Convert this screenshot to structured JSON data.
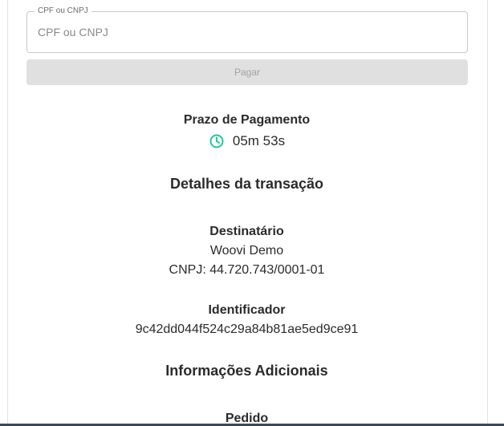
{
  "form": {
    "field_label": "CPF ou CNPJ",
    "field_placeholder": "CPF ou CNPJ",
    "field_value": "",
    "pay_button_label": "Pagar"
  },
  "payment_deadline": {
    "title": "Prazo de Pagamento",
    "time": "05m 53s",
    "icon": "clock-icon",
    "icon_color": "#1ec8a0"
  },
  "transaction": {
    "title": "Detalhes da transação",
    "recipient": {
      "label": "Destinatário",
      "name": "Woovi Demo",
      "cnpj": "CNPJ: 44.720.743/0001-01"
    },
    "identifier": {
      "label": "Identificador",
      "value": "9c42dd044f524c29a84b81ae5ed9ce91"
    }
  },
  "additional_info": {
    "title": "Informações Adicionais",
    "order_label": "Pedido"
  },
  "colors": {
    "accent": "#1ec8a0",
    "button_disabled_bg": "#e0e0e0",
    "button_disabled_text": "#a3a3a3"
  }
}
